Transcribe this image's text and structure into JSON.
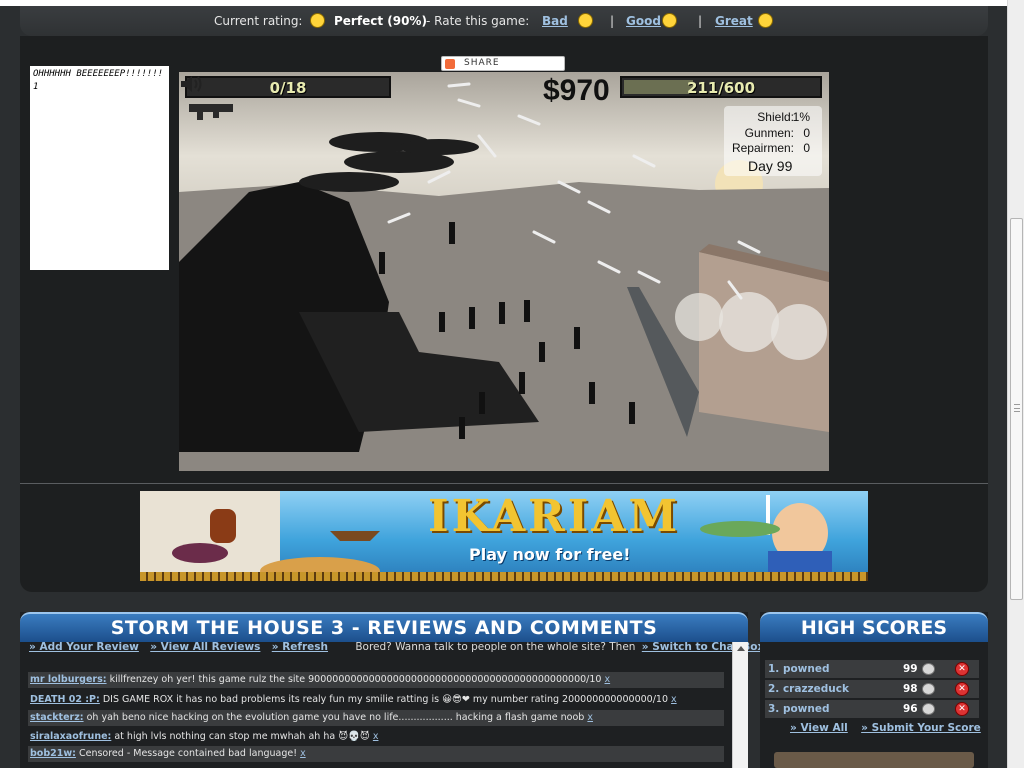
{
  "rating": {
    "current_label": "Current rating:",
    "current_value": "Perfect (90%)",
    "rate_label": "- Rate this game:",
    "options": [
      "Bad",
      "Good",
      "Great"
    ],
    "sep": "|"
  },
  "comment_box": {
    "text": "OHHHHHH BEEEEEEEP!!!!!!!1"
  },
  "share": {
    "label": "SHARE"
  },
  "game": {
    "ammo": "0/18",
    "money": "$970",
    "health": "211/600",
    "health_fraction": 0.35,
    "stats": [
      {
        "label": "Shield:",
        "value": "1%"
      },
      {
        "label": "Gunmen:",
        "value": "0"
      },
      {
        "label": "Repairmen:",
        "value": "0"
      }
    ],
    "day": "Day 99"
  },
  "ad": {
    "title": "IKARIAM",
    "subtitle": "Play now for free!"
  },
  "reviews": {
    "title": "STORM THE HOUSE 3 - REVIEWS AND COMMENTS",
    "links": [
      "» Add Your Review",
      "» View All Reviews",
      "» Refresh"
    ],
    "chat_text": "Bored? Wanna talk to people on the whole site? Then",
    "chat_link": "» Switch to Chat Box",
    "items": [
      {
        "user": "mr lolburgers:",
        "text": "killfrenzey oh yer! this game rulz the site 9000000000000000000000000000000000000000000000/10",
        "x": "x"
      },
      {
        "user": "DEATH 02 :P:",
        "text": "DIS GAME ROX it has no bad problems its realy fun my smilie ratting is 😀😎❤ my number rating 200000000000000/10",
        "x": "x"
      },
      {
        "user": "stackterz:",
        "text": "oh yah beno nice hacking on the evolution game you have no life.................. hacking a flash game noob",
        "x": "x"
      },
      {
        "user": "siralaxaofrune:",
        "text": "at high lvls nothing can stop me mwhah ah ha 😈💀😈",
        "x": "x"
      },
      {
        "user": "bob21w:",
        "text": "Censored - Message contained bad language!",
        "x": "x"
      }
    ]
  },
  "highscores": {
    "title": "HIGH SCORES",
    "rows": [
      {
        "name": "1. powned",
        "score": "99"
      },
      {
        "name": "2. crazzeduck",
        "score": "98"
      },
      {
        "name": "3. powned",
        "score": "96"
      }
    ],
    "links": [
      "» View All",
      "» Submit Your Score"
    ]
  }
}
